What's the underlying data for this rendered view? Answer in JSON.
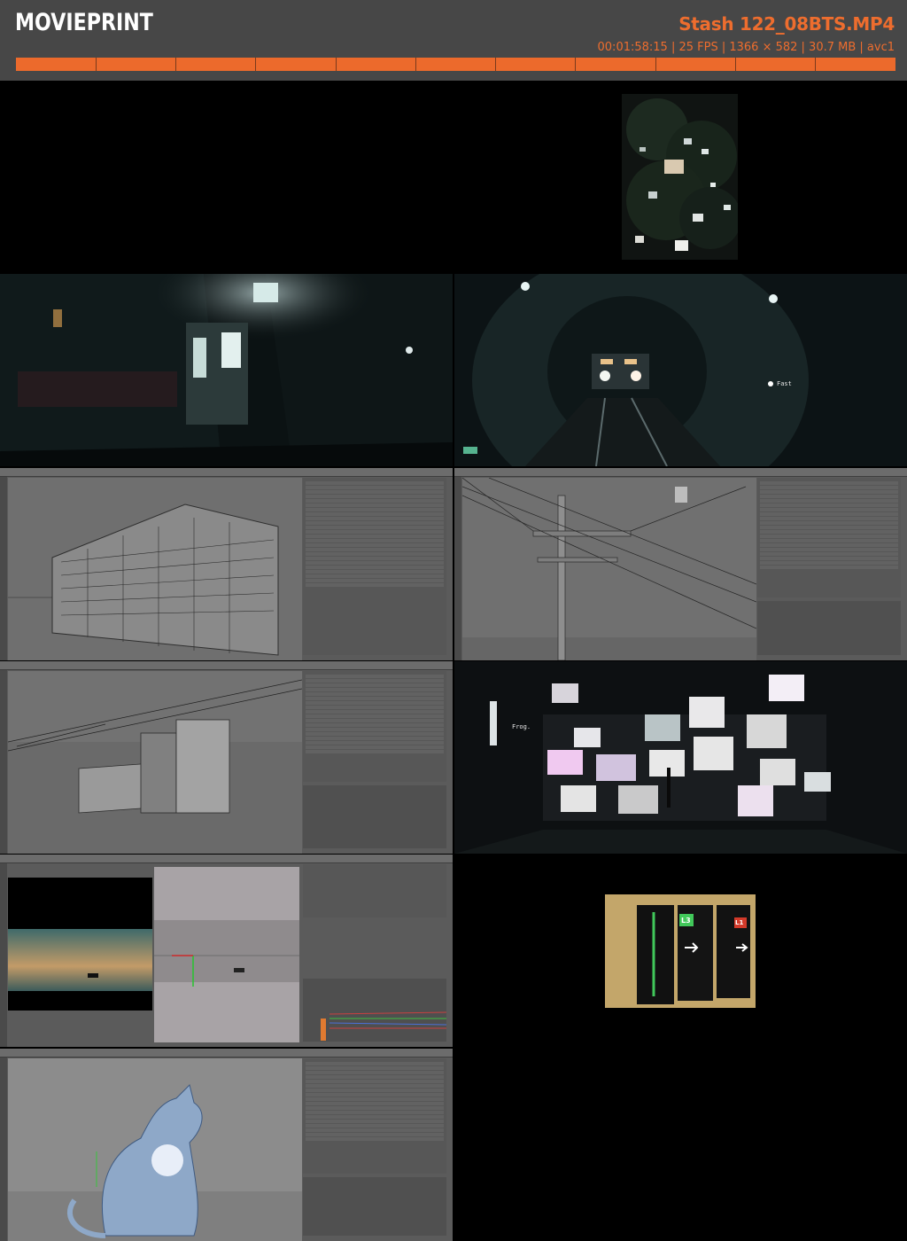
{
  "header": {
    "logo": "MOVIEPRINT",
    "file_name": "Stash 122_08BTS.MP4",
    "file_meta": "00:01:58:15 | 25 FPS | 1366 × 582 | 30.7 MB | avc1"
  },
  "colors": {
    "header_bg": "#474747",
    "accent": "#ee6d2e",
    "timeline": "#ec6a2c"
  },
  "frames": {
    "subway_overlay": "Fast",
    "tv_overlay": "Frog.",
    "sign_l3": "L3",
    "sign_l1": "L1"
  }
}
